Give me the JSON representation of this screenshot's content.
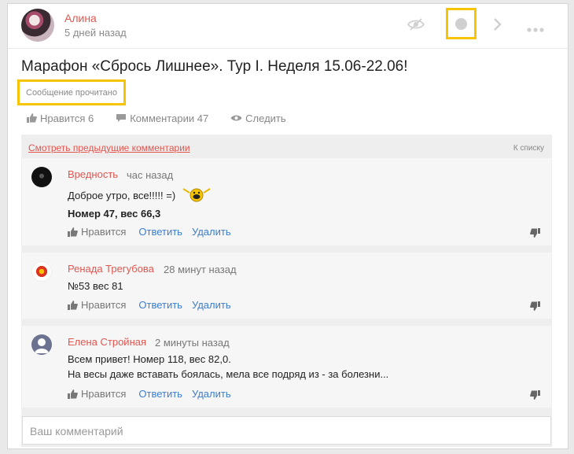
{
  "post": {
    "author": "Алина",
    "time": "5 дней назад",
    "title": "Марафон «Сбрось Лишнее». Тур I. Неделя 15.06-22.06!",
    "read_status": "Сообщение прочитано",
    "actions": {
      "like": "Нравится 6",
      "comments": "Комментарии 47",
      "follow": "Следить"
    }
  },
  "comments_section": {
    "prev_link": "Смотреть предыдущие комментарии",
    "to_list": "К списку",
    "input_placeholder": "Ваш комментарий",
    "items": [
      {
        "author": "Вредность",
        "time": "час назад",
        "lines": [
          "Доброе утро, все!!!!! =)"
        ],
        "bold_line": "Номер 47, вес 66,3",
        "like": "Нравится",
        "reply": "Ответить",
        "delete": "Удалить"
      },
      {
        "author": "Ренада Трегубова",
        "time": "28 минут назад",
        "lines": [
          "№53 вес 81"
        ],
        "like": "Нравится",
        "reply": "Ответить",
        "delete": "Удалить"
      },
      {
        "author": "Елена Стройная",
        "time": "2 минуты назад",
        "lines": [
          "Всем привет! Номер 118, вес 82,0.",
          "На весы даже вставать боялась, мела все подряд из - за болезни..."
        ],
        "like": "Нравится",
        "reply": "Ответить",
        "delete": "Удалить"
      }
    ]
  },
  "colors": {
    "accent_red": "#e2564f",
    "link_blue": "#3d7dcc",
    "highlight_yellow": "#f6c400"
  },
  "icons": [
    "eye-off-icon",
    "circle-icon",
    "chevron-right-icon",
    "more-icon",
    "thumbs-up-icon",
    "comment-icon",
    "eye-icon",
    "thumbs-down-icon"
  ]
}
